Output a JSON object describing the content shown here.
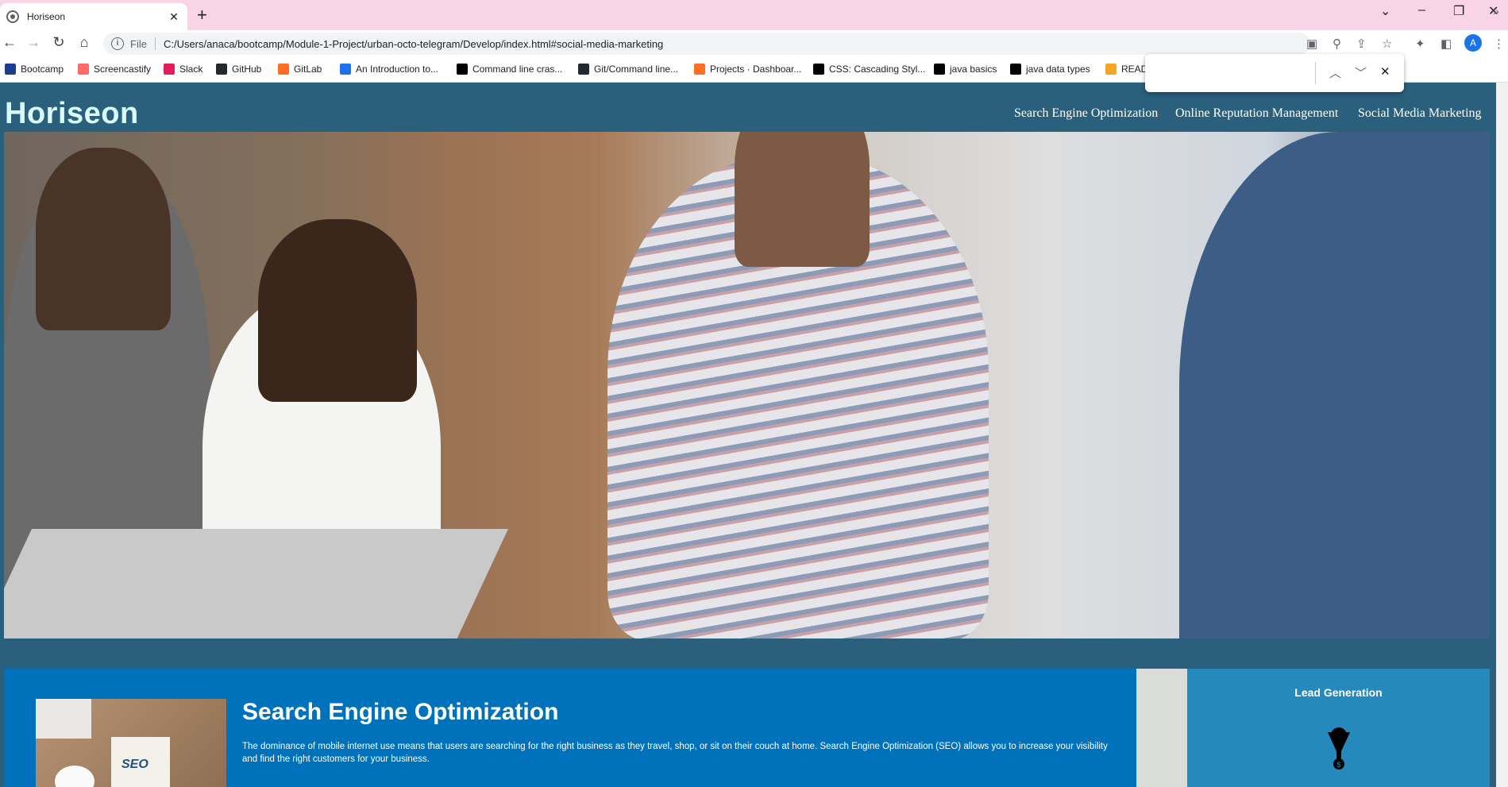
{
  "browser": {
    "tab_title": "Horiseon",
    "tab_close": "✕",
    "new_tab": "+",
    "url_scheme_label": "File",
    "url": "C:/Users/anaca/bootcamp/Module-1-Project/urban-octo-telegram/Develop/index.html#social-media-marketing",
    "profile_initial": "A",
    "bookmarks": [
      {
        "label": "Bootcamp",
        "color": "#1a3e8c"
      },
      {
        "label": "Screencastify",
        "color": "#ff6b6b"
      },
      {
        "label": "Slack",
        "color": "#e01e5a"
      },
      {
        "label": "GitHub",
        "color": "#24292e"
      },
      {
        "label": "GitLab",
        "color": "#fc6d26"
      },
      {
        "label": "An Introduction to...",
        "color": "#1a73e8"
      },
      {
        "label": "Command line cras...",
        "color": "#000000"
      },
      {
        "label": "Git/Command line...",
        "color": "#24292e"
      },
      {
        "label": "Projects · Dashboar...",
        "color": "#fc6d26"
      },
      {
        "label": "CSS: Cascading Styl...",
        "color": "#000000"
      },
      {
        "label": "java basics",
        "color": "#000000"
      },
      {
        "label": "java data types",
        "color": "#000000"
      },
      {
        "label": "READ",
        "color": "#f5a623"
      }
    ]
  },
  "site": {
    "logo": "Horiseon",
    "nav": [
      "Search Engine Optimization",
      "Online Reputation Management",
      "Social Media Marketing"
    ],
    "seo": {
      "title": "Search Engine Optimization",
      "text": "The dominance of mobile internet use means that users are searching for the right business as they travel, shop, or sit on their couch at home. Search Engine Optimization (SEO) allows you to increase your visibility and find the right customers for your business.",
      "image_text": "SEO"
    },
    "lead": {
      "title": "Lead Generation"
    }
  }
}
